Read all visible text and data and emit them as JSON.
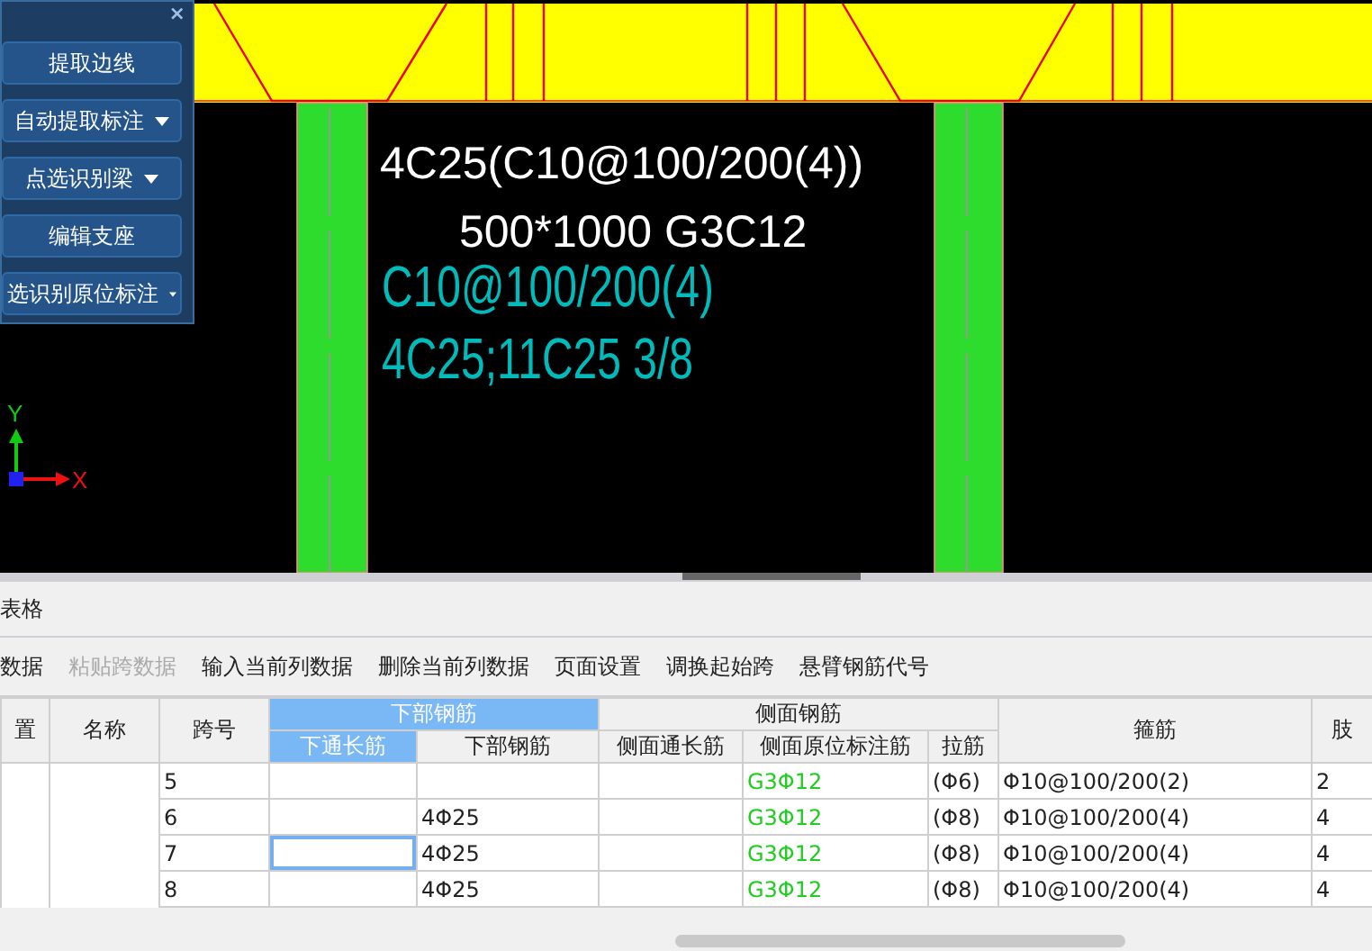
{
  "canvas": {
    "annotations": [
      {
        "kind": "primary",
        "text": "4C25(C10@100/200(4))"
      },
      {
        "kind": "primary",
        "text": "500*1000 G3C12"
      },
      {
        "kind": "secondary",
        "text": "C10@100/200(4)"
      },
      {
        "kind": "secondary",
        "text": "4C25;11C25 3/8"
      }
    ],
    "axis_labels": [
      "Y",
      "X"
    ]
  },
  "tool_panel": {
    "close": "×",
    "buttons": [
      {
        "label": "提取边线",
        "dropdown": false
      },
      {
        "label": "自动提取标注",
        "dropdown": true
      },
      {
        "label": "点选识别梁",
        "dropdown": true
      },
      {
        "label": "编辑支座",
        "dropdown": false
      },
      {
        "label": "选识别原位标注",
        "dropdown": true
      }
    ]
  },
  "table_panel": {
    "title": "表格",
    "toolbar": [
      {
        "label": "数据",
        "disabled": false
      },
      {
        "label": "粘贴跨数据",
        "disabled": true
      },
      {
        "label": "输入当前列数据",
        "disabled": false
      },
      {
        "label": "删除当前列数据",
        "disabled": false
      },
      {
        "label": "页面设置",
        "disabled": false
      },
      {
        "label": "调换起始跨",
        "disabled": false
      },
      {
        "label": "悬臂钢筋代号",
        "disabled": false
      }
    ],
    "columns": [
      {
        "label": "置",
        "selected": false
      },
      {
        "label": "名称",
        "selected": false
      },
      {
        "label": "跨号",
        "selected": false
      },
      {
        "label": "下部钢筋",
        "selected": true,
        "colspan": 2,
        "children": [
          {
            "label": "下通长筋",
            "selected": true
          },
          {
            "label": "下部钢筋",
            "selected": false
          }
        ]
      },
      {
        "label": "侧面钢筋",
        "selected": false,
        "colspan": 3,
        "children": [
          {
            "label": "侧面通长筋",
            "selected": false
          },
          {
            "label": "侧面原位标注筋",
            "selected": false,
            "color": "#22cc22"
          },
          {
            "label": "拉筋",
            "selected": false
          }
        ]
      },
      {
        "label": "箍筋",
        "selected": false
      },
      {
        "label": "肢",
        "selected": false
      }
    ],
    "rows": [
      {
        "selected": false,
        "cells": [
          "",
          "",
          "5",
          "",
          "",
          "",
          "G3Φ12",
          "(Φ6)",
          "Φ10@100/200(2)",
          "2"
        ]
      },
      {
        "selected": false,
        "cells": [
          "",
          "",
          "6",
          "",
          "4Φ25",
          "",
          "G3Φ12",
          "(Φ8)",
          "Φ10@100/200(4)",
          "4"
        ]
      },
      {
        "selected": true,
        "cells": [
          "",
          "",
          "7",
          "",
          "4Φ25",
          "",
          "G3Φ12",
          "(Φ8)",
          "Φ10@100/200(4)",
          "4"
        ]
      },
      {
        "selected": false,
        "cells": [
          "",
          "",
          "8",
          "",
          "4Φ25",
          "",
          "G3Φ12",
          "(Φ8)",
          "Φ10@100/200(4)",
          "4"
        ]
      }
    ]
  }
}
